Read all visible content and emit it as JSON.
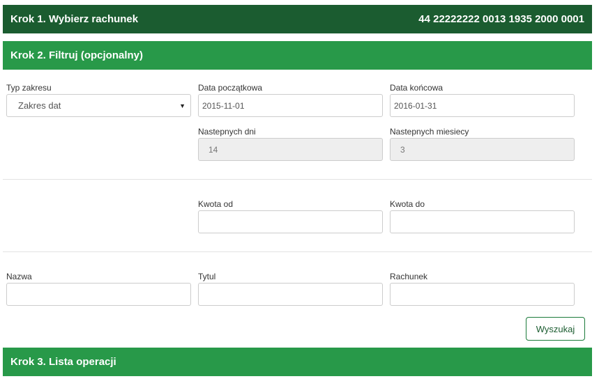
{
  "step1": {
    "title": "Krok 1. Wybierz rachunek",
    "account_number": "44 22222222 0013 1935 2000 0001"
  },
  "step2": {
    "title": "Krok 2. Filtruj (opcjonalny)",
    "range_type": {
      "label": "Typ zakresu",
      "value": "Zakres dat"
    },
    "date_from": {
      "label": "Data początkowa",
      "value": "2015-11-01"
    },
    "date_to": {
      "label": "Data końcowa",
      "value": "2016-01-31"
    },
    "next_days": {
      "label": "Nastepnych dni",
      "value": "14"
    },
    "next_months": {
      "label": "Nastepnych miesiecy",
      "value": "3"
    },
    "amount_from": {
      "label": "Kwota od",
      "value": ""
    },
    "amount_to": {
      "label": "Kwota do",
      "value": ""
    },
    "name": {
      "label": "Nazwa",
      "value": ""
    },
    "title_field": {
      "label": "Tytul",
      "value": ""
    },
    "account": {
      "label": "Rachunek",
      "value": ""
    },
    "search_label": "Wyszukaj"
  },
  "step3": {
    "title": "Krok 3. Lista operacji"
  },
  "icons": {
    "dropdown": "caret-down-icon"
  },
  "colors": {
    "step1_bg": "#1b5c30",
    "step_bg": "#289949",
    "button_border": "#1b7a3a"
  }
}
